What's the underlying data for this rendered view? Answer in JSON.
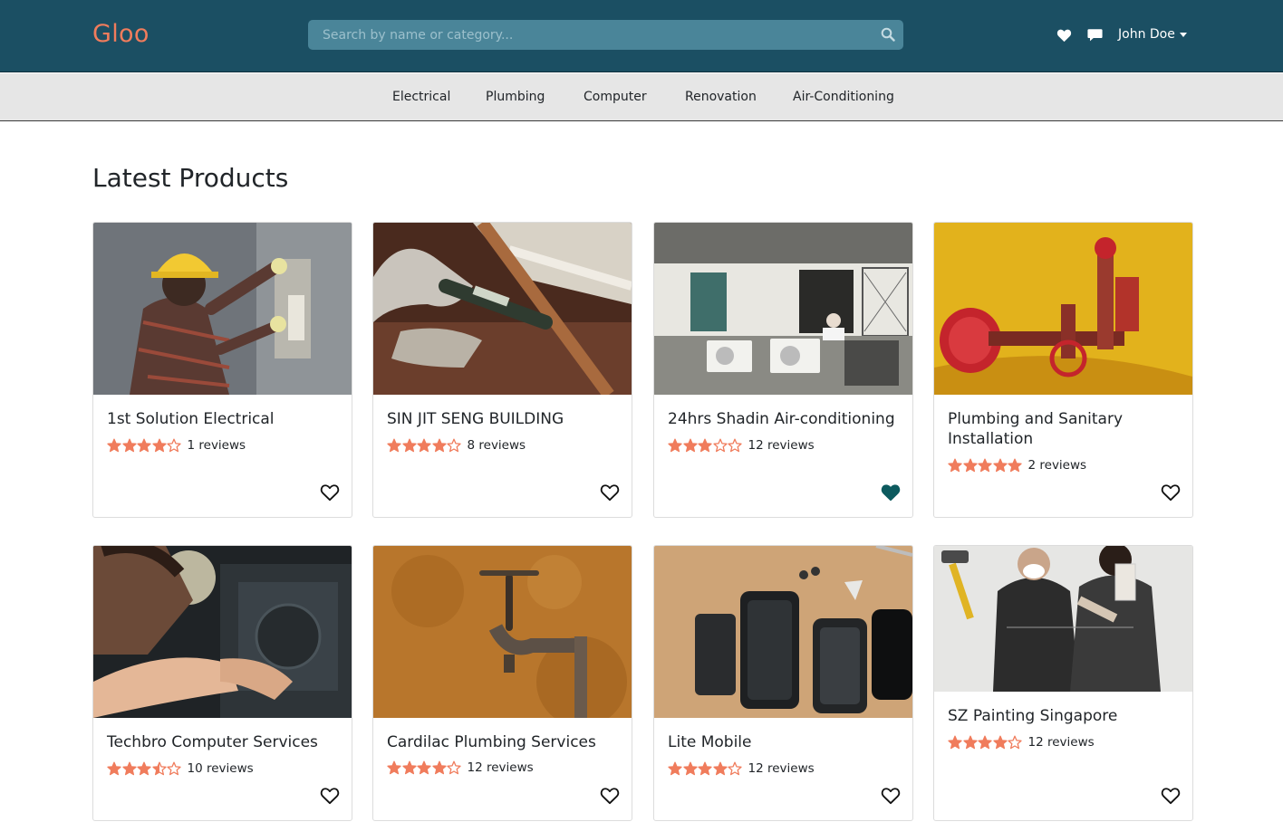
{
  "header": {
    "brand": "Gloo",
    "search_placeholder": "Search by name or category...",
    "user_name": "John Doe"
  },
  "categories": [
    "Electrical",
    "Plumbing",
    "Computer",
    "Renovation",
    "Air-Conditioning"
  ],
  "page_title": "Latest Products",
  "products": [
    {
      "title": "1st Solution Electrical",
      "rating": 4,
      "reviews": "1 reviews",
      "favorited": false
    },
    {
      "title": "SIN JIT SENG BUILDING",
      "rating": 4,
      "reviews": "8 reviews",
      "favorited": false
    },
    {
      "title": "24hrs Shadin Air-conditioning",
      "rating": 3,
      "reviews": "12 reviews",
      "favorited": true
    },
    {
      "title": "Plumbing and Sanitary Installation",
      "rating": 5,
      "reviews": "2 reviews",
      "favorited": false
    },
    {
      "title": "Techbro Computer Services",
      "rating": 3.5,
      "reviews": "10 reviews",
      "favorited": false
    },
    {
      "title": "Cardilac Plumbing Services",
      "rating": 4,
      "reviews": "12 reviews",
      "favorited": false
    },
    {
      "title": "Lite Mobile",
      "rating": 4,
      "reviews": "12 reviews",
      "favorited": false
    },
    {
      "title": "SZ Painting Singapore",
      "rating": 4,
      "reviews": "12 reviews",
      "favorited": false
    }
  ],
  "colors": {
    "navbar": "#1b4f63",
    "brand": "#f07c5c",
    "star": "#f07c5c",
    "favorite": "#0d5a5e"
  },
  "icons": {
    "search": "search-icon",
    "favorites": "heart-icon",
    "messages": "chat-icon",
    "card_favorite": "heart-outline-icon"
  }
}
